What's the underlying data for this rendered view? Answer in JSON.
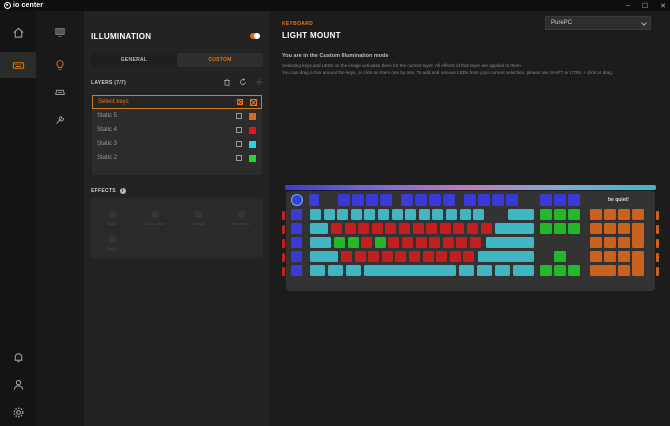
{
  "app": {
    "brand": "io center"
  },
  "window": {
    "min": "–",
    "max": "☐",
    "close": "✕"
  },
  "rail": [
    "home-icon",
    "keyboard-icon",
    "bell-icon",
    "user-icon",
    "gear-icon"
  ],
  "col2": [
    "monitor-icon",
    "bulb-icon",
    "key-icon",
    "wrench-icon"
  ],
  "illumination": {
    "title": "ILLUMINATION",
    "enabled": true,
    "tabs": [
      {
        "label": "GENERAL",
        "active": false
      },
      {
        "label": "CUSTOM",
        "active": true
      }
    ],
    "layers_label": "LAYERS (7/7)",
    "layers": [
      {
        "name": "Select keys",
        "color": "",
        "selected": true
      },
      {
        "name": "Static 5",
        "color": "#e06a12",
        "selected": false
      },
      {
        "name": "Static 4",
        "color": "#e01818",
        "selected": false
      },
      {
        "name": "Static 3",
        "color": "#22d6e6",
        "selected": false
      },
      {
        "name": "Static 2",
        "color": "#22d62a",
        "selected": false
      }
    ],
    "effects_label": "EFFECTS",
    "effects": [
      "Static",
      "Color wave",
      "Tornado",
      "Breathing",
      "Ripple"
    ]
  },
  "main": {
    "kicker": "KEYBOARD",
    "title": "LIGHT MOUNT",
    "device": "PurePC",
    "mode_title": "You are in the Custom Illumination mode",
    "mode_desc_1": "Selecting keys and LEDs on the image activates them for the current layer. All effects of that layer are applied to them.",
    "mode_desc_2": "You can drag a box around the keys, or click on them one by one. To add and remove LEDs from your current selection, please use SHIFT or CTRL + click or drag.",
    "keyboard_logo": "be quiet!"
  },
  "colors": {
    "accent": "#e8740f",
    "blue": "#3a3ad6",
    "cyan": "#3fb6c2",
    "red": "#c22020",
    "green": "#22b82a",
    "orange": "#c8621e"
  }
}
